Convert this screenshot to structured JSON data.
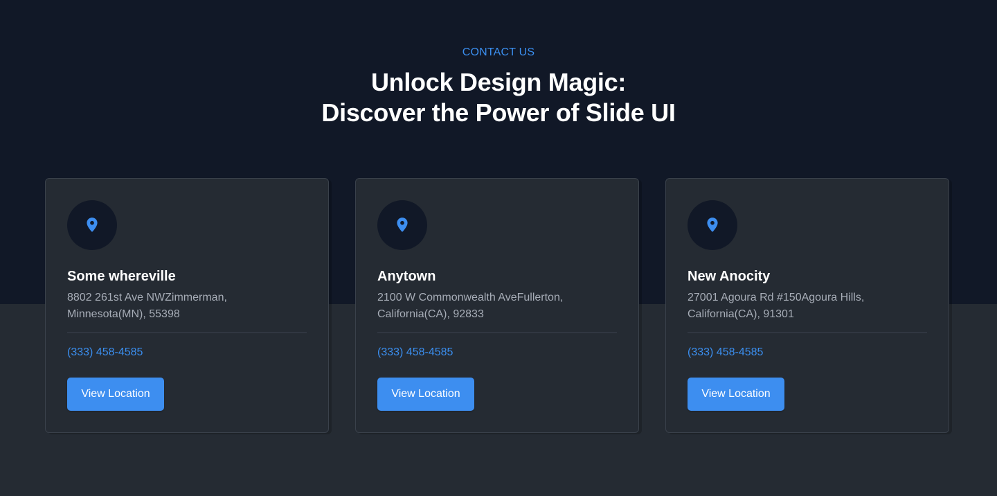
{
  "header": {
    "eyebrow": "CONTACT US",
    "headline_line1": "Unlock Design Magic:",
    "headline_line2": "Discover the Power of Slide UI"
  },
  "colors": {
    "accent": "#3d8ef0",
    "top_background": "#111827",
    "bottom_background": "#252b33"
  },
  "cards": [
    {
      "icon": "map-pin-icon",
      "title": "Some whereville",
      "address_line1": "8802 261st Ave NWZimmerman,",
      "address_line2": "Minnesota(MN), 55398",
      "phone": "(333) 458-4585",
      "button_label": "View Location"
    },
    {
      "icon": "map-pin-icon",
      "title": "Anytown",
      "address_line1": "2100 W Commonwealth AveFullerton,",
      "address_line2": "California(CA), 92833",
      "phone": "(333) 458-4585",
      "button_label": "View Location"
    },
    {
      "icon": "map-pin-icon",
      "title": "New Anocity",
      "address_line1": "27001 Agoura Rd #150Agoura Hills,",
      "address_line2": "California(CA), 91301",
      "phone": "(333) 458-4585",
      "button_label": "View Location"
    }
  ]
}
